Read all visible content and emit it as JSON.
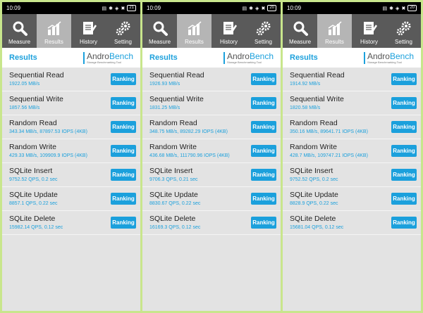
{
  "phones": [
    {
      "time": "10:09",
      "battery": "21",
      "tabs": [
        {
          "label": "Measure",
          "icon": "magnifier-icon"
        },
        {
          "label": "Results",
          "icon": "bar-chart-icon"
        },
        {
          "label": "History",
          "icon": "notepad-icon"
        },
        {
          "label": "Setting",
          "icon": "gears-icon"
        }
      ],
      "header": {
        "title": "Results",
        "brand_a": "Andro",
        "brand_b": "Bench",
        "brand_sub": "Storage Benchmarking Tool"
      },
      "rows": [
        {
          "name": "Sequential Read",
          "value": "1922.05 MB/s",
          "button": "Ranking"
        },
        {
          "name": "Sequential Write",
          "value": "1857.56 MB/s",
          "button": "Ranking"
        },
        {
          "name": "Random Read",
          "value": "343.34 MB/s, 87897.53 IOPS (4KB)",
          "button": "Ranking"
        },
        {
          "name": "Random Write",
          "value": "429.33 MB/s, 109909.9 IOPS (4KB)",
          "button": "Ranking"
        },
        {
          "name": "SQLite Insert",
          "value": "9752.52 QPS, 0.2 sec",
          "button": "Ranking"
        },
        {
          "name": "SQLite Update",
          "value": "8857.1 QPS, 0.22 sec",
          "button": "Ranking"
        },
        {
          "name": "SQLite Delete",
          "value": "15982.14 QPS, 0.12 sec",
          "button": "Ranking"
        }
      ]
    },
    {
      "time": "10:09",
      "battery": "20",
      "tabs": [
        {
          "label": "Measure",
          "icon": "magnifier-icon"
        },
        {
          "label": "Results",
          "icon": "bar-chart-icon"
        },
        {
          "label": "History",
          "icon": "notepad-icon"
        },
        {
          "label": "Setting",
          "icon": "gears-icon"
        }
      ],
      "header": {
        "title": "Results",
        "brand_a": "Andro",
        "brand_b": "Bench",
        "brand_sub": "Storage Benchmarking Tool"
      },
      "rows": [
        {
          "name": "Sequential Read",
          "value": "1926.93 MB/s",
          "button": "Ranking"
        },
        {
          "name": "Sequential Write",
          "value": "1831.25 MB/s",
          "button": "Ranking"
        },
        {
          "name": "Random Read",
          "value": "348.75 MB/s, 89282.29 IOPS (4KB)",
          "button": "Ranking"
        },
        {
          "name": "Random Write",
          "value": "436.68 MB/s, 111790.96 IOPS (4KB)",
          "button": "Ranking"
        },
        {
          "name": "SQLite Insert",
          "value": "9706.3 QPS, 0.21 sec",
          "button": "Ranking"
        },
        {
          "name": "SQLite Update",
          "value": "8830.67 QPS, 0.22 sec",
          "button": "Ranking"
        },
        {
          "name": "SQLite Delete",
          "value": "16169.3 QPS, 0.12 sec",
          "button": "Ranking"
        }
      ]
    },
    {
      "time": "10:09",
      "battery": "20",
      "tabs": [
        {
          "label": "Measure",
          "icon": "magnifier-icon"
        },
        {
          "label": "Results",
          "icon": "bar-chart-icon"
        },
        {
          "label": "History",
          "icon": "notepad-icon"
        },
        {
          "label": "Setting",
          "icon": "gears-icon"
        }
      ],
      "header": {
        "title": "Results",
        "brand_a": "Andro",
        "brand_b": "Bench",
        "brand_sub": "Storage Benchmarking Tool"
      },
      "rows": [
        {
          "name": "Sequential Read",
          "value": "1914.92 MB/s",
          "button": "Ranking"
        },
        {
          "name": "Sequential Write",
          "value": "1820.58 MB/s",
          "button": "Ranking"
        },
        {
          "name": "Random Read",
          "value": "350.16 MB/s, 89641.71 IOPS (4KB)",
          "button": "Ranking"
        },
        {
          "name": "Random Write",
          "value": "428.7 MB/s, 109747.21 IOPS (4KB)",
          "button": "Ranking"
        },
        {
          "name": "SQLite Insert",
          "value": "9752.52 QPS, 0.2 sec",
          "button": "Ranking"
        },
        {
          "name": "SQLite Update",
          "value": "8828.9 QPS, 0.22 sec",
          "button": "Ranking"
        },
        {
          "name": "SQLite Delete",
          "value": "15681.04 QPS, 0.12 sec",
          "button": "Ranking"
        }
      ]
    }
  ],
  "colors": {
    "accent": "#1ba0dc",
    "toolbar": "#5a5a5a",
    "active_tab": "#b5b5b5",
    "frame": "#c8e68c"
  }
}
